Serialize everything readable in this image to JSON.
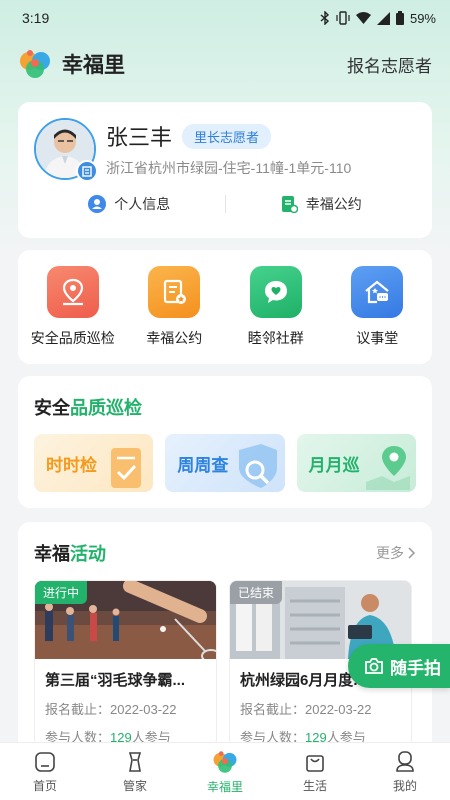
{
  "status_bar": {
    "time": "3:19",
    "battery": "59%"
  },
  "header": {
    "title": "幸福里",
    "action": "报名志愿者"
  },
  "profile": {
    "name": "张三丰",
    "role": "里长志愿者",
    "address": "浙江省杭州市绿园-住宅-11幢-1单元-110",
    "links": [
      {
        "label": "个人信息",
        "icon": "person-icon"
      },
      {
        "label": "幸福公约",
        "icon": "document-icon"
      }
    ]
  },
  "quick_menu": [
    {
      "label": "安全品质巡检",
      "icon": "location-pin-icon",
      "color": "#f2705c"
    },
    {
      "label": "幸福公约",
      "icon": "document-star-icon",
      "color": "#f8a23a"
    },
    {
      "label": "睦邻社群",
      "icon": "chat-heart-icon",
      "color": "#2fc27a"
    },
    {
      "label": "议事堂",
      "icon": "house-chat-icon",
      "color": "#3f89ea"
    }
  ],
  "patrol": {
    "title_prefix": "安全",
    "title_accent": "品质巡检",
    "tiles": [
      {
        "label": "时时检",
        "color": "#f39b1e"
      },
      {
        "label": "周周查",
        "color": "#2f83e0"
      },
      {
        "label": "月月巡",
        "color": "#23b26b"
      }
    ]
  },
  "activities": {
    "title_prefix": "幸福",
    "title_accent": "活动",
    "more": "更多",
    "items": [
      {
        "tag": "进行中",
        "tag_color": "#23b26b",
        "title": "第三届“羽毛球争霸...",
        "deadline_label": "报名截止：",
        "deadline": "2022-03-22",
        "count_label": "参与人数：",
        "count": "129",
        "count_suffix": "人参与"
      },
      {
        "tag": "已结束",
        "tag_color": "#9aa0a6",
        "title": "杭州绿园6月月度...",
        "deadline_label": "报名截止：",
        "deadline": "2022-03-22",
        "count_label": "参与人数：",
        "count": "129",
        "count_suffix": "人参与"
      }
    ]
  },
  "fab": {
    "label": "随手拍"
  },
  "tabbar": [
    {
      "label": "首页",
      "active": false
    },
    {
      "label": "管家",
      "active": false
    },
    {
      "label": "幸福里",
      "active": true
    },
    {
      "label": "生活",
      "active": false
    },
    {
      "label": "我的",
      "active": false
    }
  ]
}
